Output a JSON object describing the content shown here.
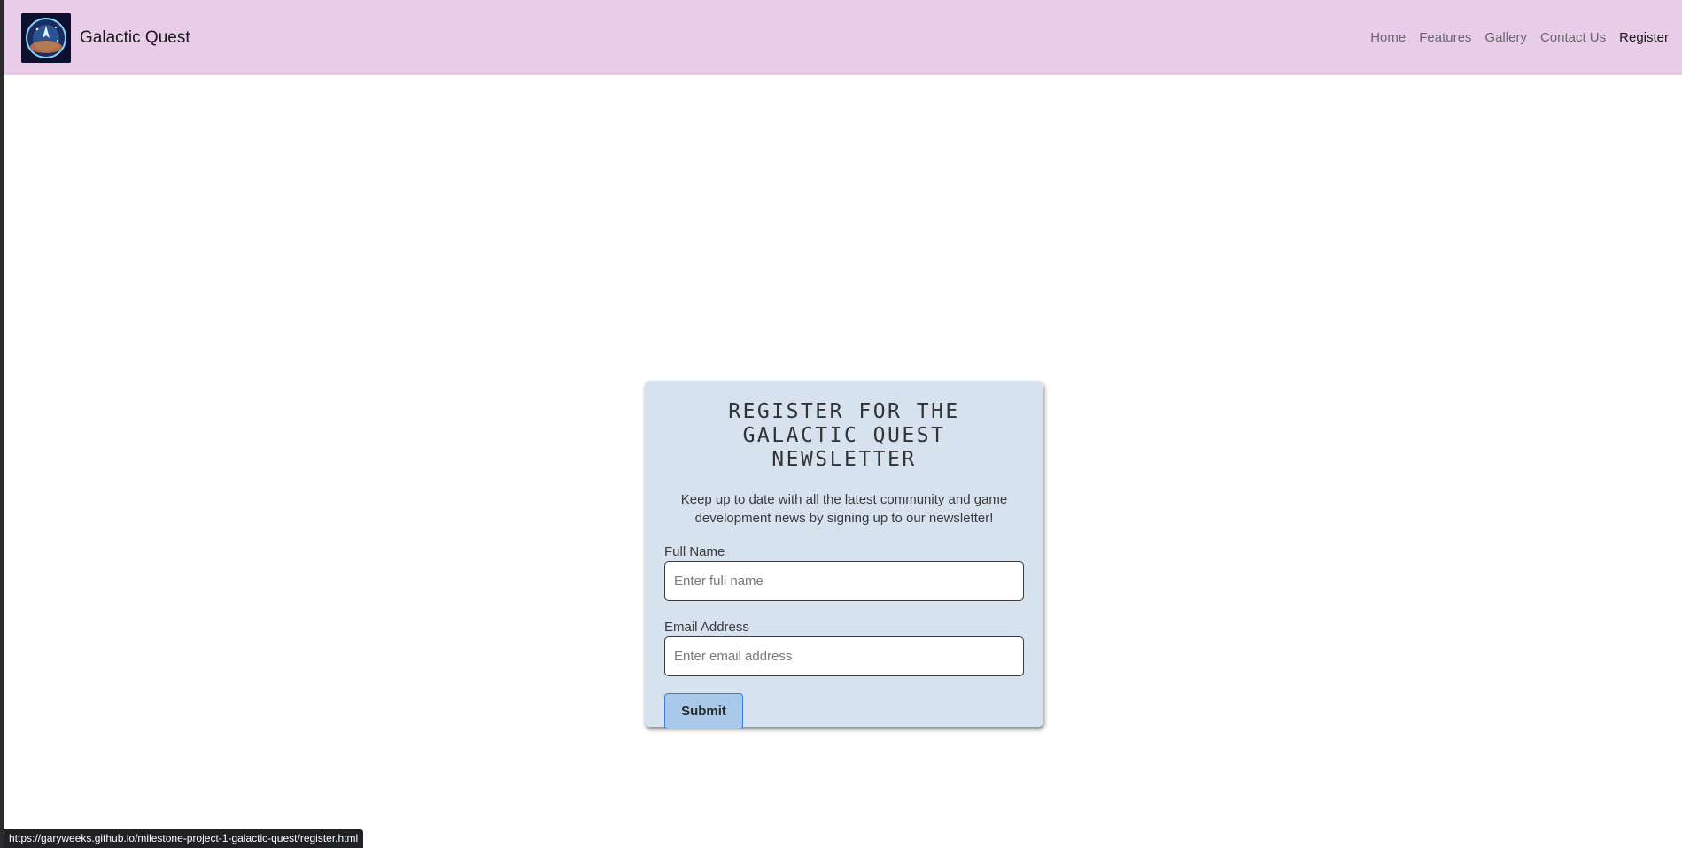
{
  "brand": {
    "name": "Galactic Quest",
    "logo_icon": "galactic-quest-logo-icon"
  },
  "nav": {
    "items": [
      {
        "label": "Home"
      },
      {
        "label": "Features"
      },
      {
        "label": "Gallery"
      },
      {
        "label": "Contact Us"
      },
      {
        "label": "Register"
      }
    ],
    "active": "Register"
  },
  "register": {
    "title": "REGISTER FOR THE GALACTIC QUEST NEWSLETTER",
    "description": "Keep up to date with all the latest community and game development news by signing up to our newsletter!",
    "full_name": {
      "label": "Full Name",
      "placeholder": "Enter full name",
      "value": ""
    },
    "email": {
      "label": "Email Address",
      "placeholder": "Enter email address",
      "value": ""
    },
    "submit_label": "Submit"
  },
  "status_bar": {
    "url": "https://garyweeks.github.io/milestone-project-1-galactic-quest/register.html"
  },
  "colors": {
    "navbar_bg": "#e8cce8",
    "card_bg": "#d6e2ee",
    "button_bg": "#a9c9ea",
    "button_border": "#3b7fd4"
  }
}
